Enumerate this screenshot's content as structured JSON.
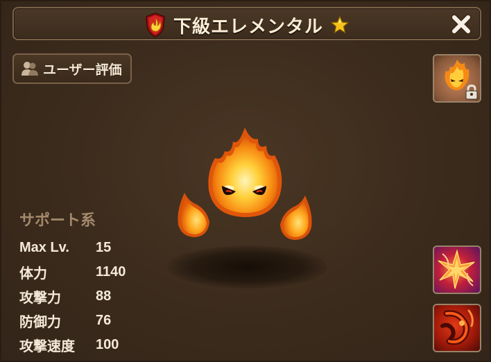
{
  "window": {
    "title": "下級エレメンタル",
    "element": "fire",
    "stars": 1
  },
  "user_rating": {
    "label": "ユーザー評価"
  },
  "monster": {
    "category": "サポート系",
    "stats": [
      {
        "label": "Max Lv.",
        "value": "15"
      },
      {
        "label": "体力",
        "value": "1140"
      },
      {
        "label": "攻撃力",
        "value": "88"
      },
      {
        "label": "防御力",
        "value": "76"
      },
      {
        "label": "攻撃速度",
        "value": "100"
      }
    ]
  },
  "icons": {
    "element_badge": "fire-element-badge-icon",
    "star": "star-icon",
    "close": "close-icon",
    "users": "users-icon",
    "lock": "lock-icon",
    "skill_1": "fire-burst-skill-icon",
    "skill_2": "fire-claw-skill-icon"
  },
  "colors": {
    "background": "#3b2b1c",
    "title_text": "#fbeed6",
    "category_text": "#a4896c",
    "border": "#7a6248",
    "star": "#f6c21b"
  }
}
